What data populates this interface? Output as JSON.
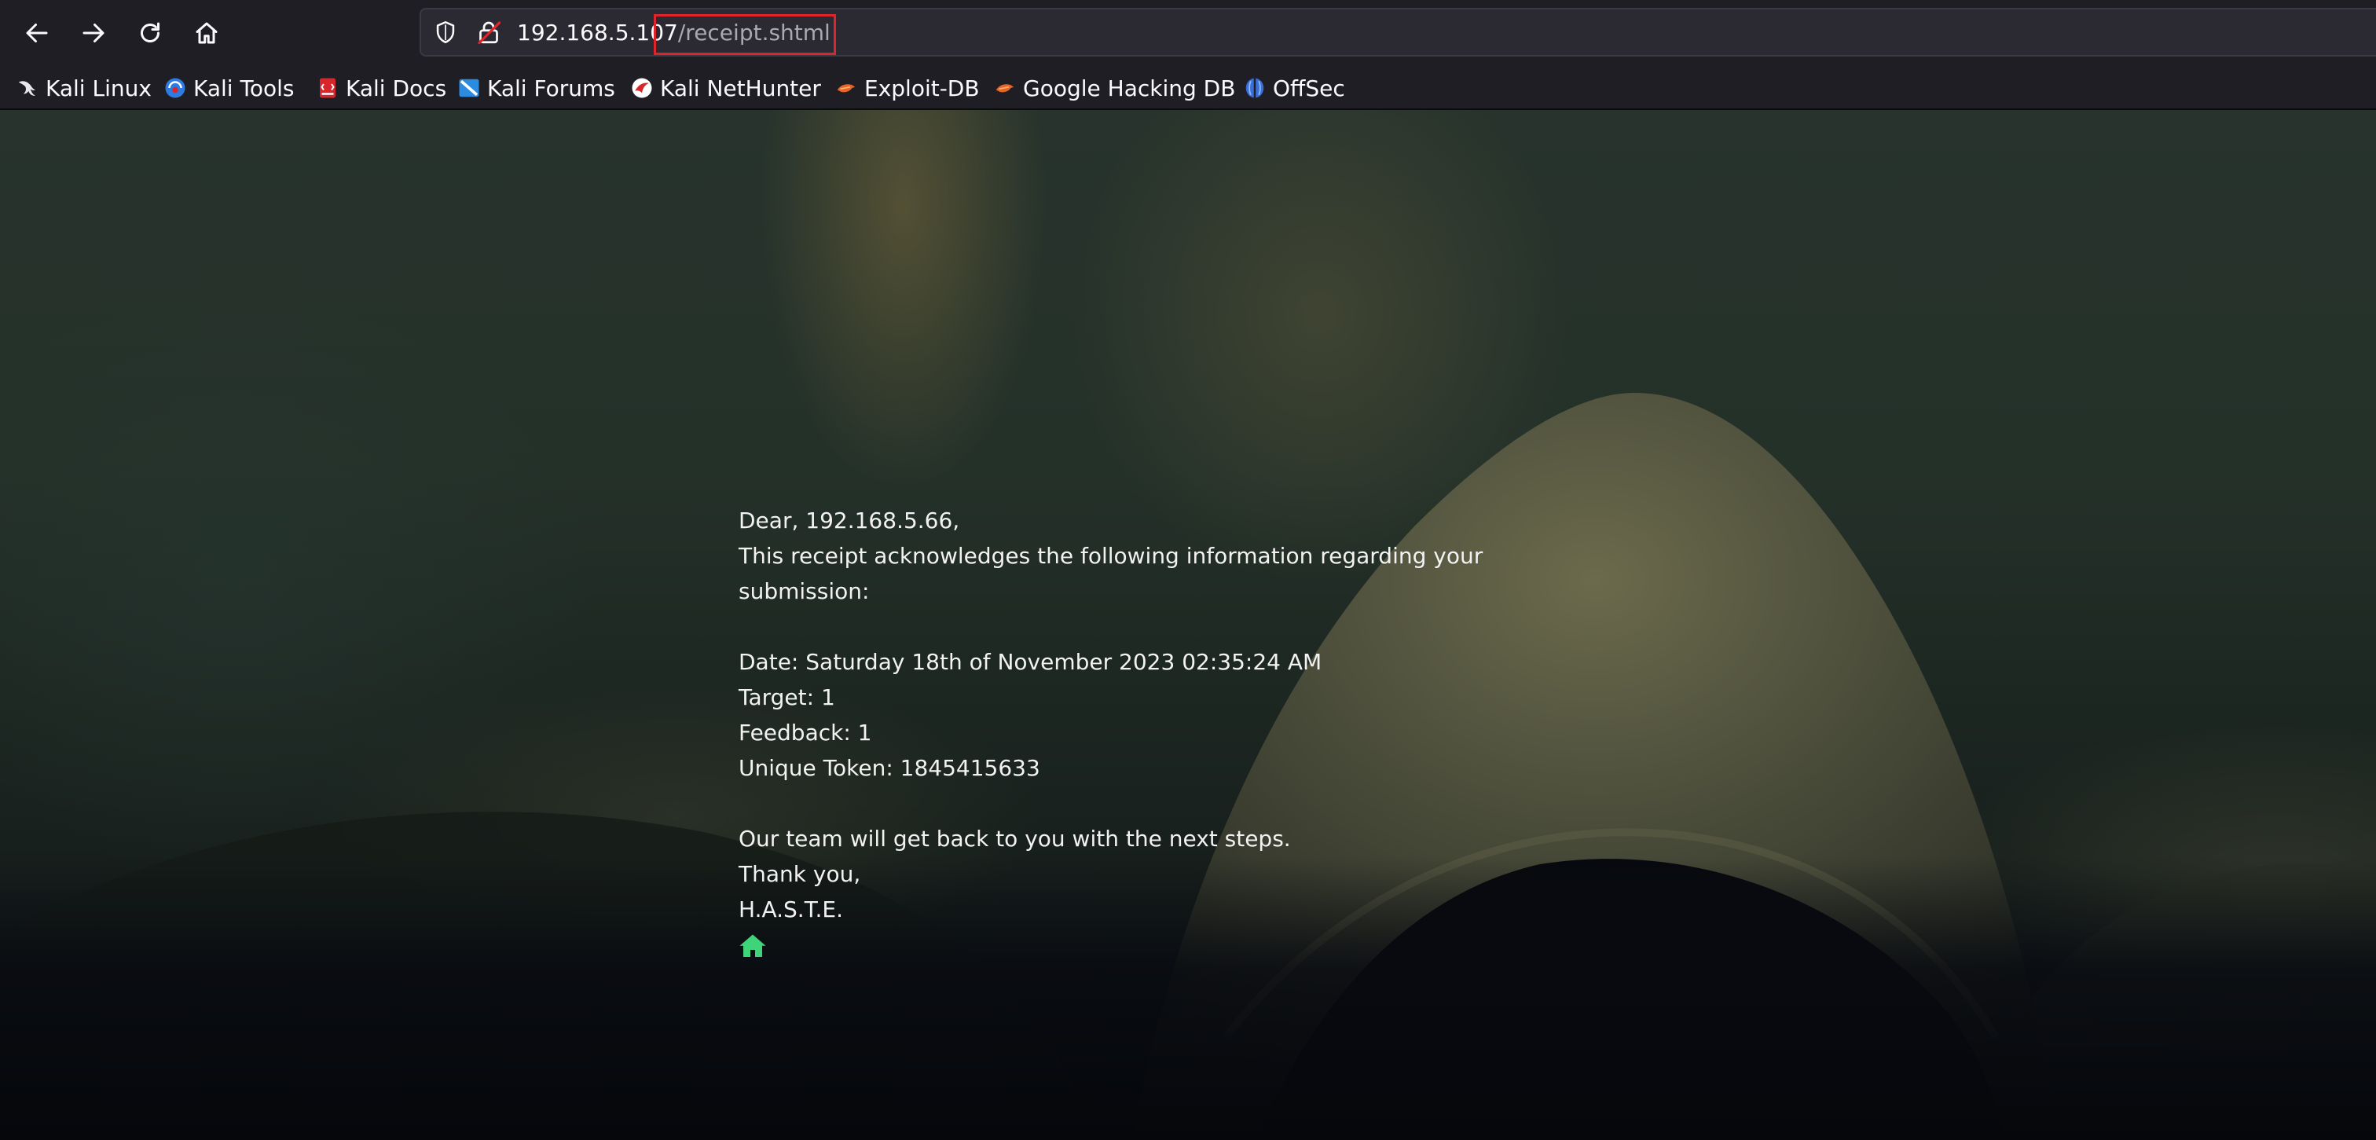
{
  "browser": {
    "url_host": "192.168.5.107",
    "url_path": "/receipt.shtml"
  },
  "bookmarks": [
    {
      "label": "Kali Linux",
      "icon": "kali-dragon-icon"
    },
    {
      "label": "Kali Tools",
      "icon": "kali-tools-icon"
    },
    {
      "label": "Kali Docs",
      "icon": "kali-docs-icon"
    },
    {
      "label": "Kali Forums",
      "icon": "kali-forums-icon"
    },
    {
      "label": "Kali NetHunter",
      "icon": "kali-nethunter-icon"
    },
    {
      "label": "Exploit-DB",
      "icon": "exploit-db-icon"
    },
    {
      "label": "Google Hacking DB",
      "icon": "ghdb-icon"
    },
    {
      "label": "OffSec",
      "icon": "offsec-icon"
    }
  ],
  "receipt": {
    "greeting": "Dear, 192.168.5.66,",
    "intro": "This receipt acknowledges the following information regarding your submission:",
    "date": "Date: Saturday 18th of November 2023 02:35:24 AM",
    "target": "Target: 1",
    "feedback": "Feedback: 1",
    "token": "Unique Token: 1845415633",
    "followup": "Our team will get back to you with the next steps.",
    "closing": "Thank you,",
    "signature": "H.A.S.T.E."
  },
  "colors": {
    "toolbar_bg": "#1f1e25",
    "urlbar_bg": "#2b2a33",
    "highlight_box": "#e0242b",
    "home_icon": "#3fd37a",
    "text": "#f2f2f2"
  }
}
